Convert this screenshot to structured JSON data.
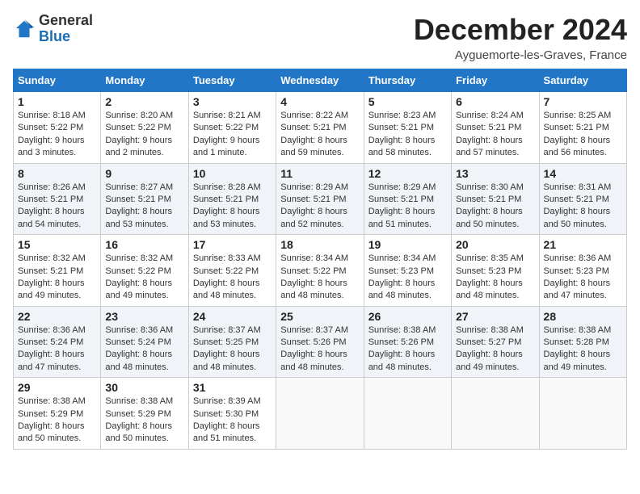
{
  "header": {
    "logo": {
      "general": "General",
      "blue": "Blue"
    },
    "title": "December 2024",
    "location": "Ayguemorte-les-Graves, France"
  },
  "weekdays": [
    "Sunday",
    "Monday",
    "Tuesday",
    "Wednesday",
    "Thursday",
    "Friday",
    "Saturday"
  ],
  "weeks": [
    [
      {
        "day": "1",
        "sunrise": "8:18 AM",
        "sunset": "5:22 PM",
        "daylight": "9 hours and 3 minutes."
      },
      {
        "day": "2",
        "sunrise": "8:20 AM",
        "sunset": "5:22 PM",
        "daylight": "9 hours and 2 minutes."
      },
      {
        "day": "3",
        "sunrise": "8:21 AM",
        "sunset": "5:22 PM",
        "daylight": "9 hours and 1 minute."
      },
      {
        "day": "4",
        "sunrise": "8:22 AM",
        "sunset": "5:21 PM",
        "daylight": "8 hours and 59 minutes."
      },
      {
        "day": "5",
        "sunrise": "8:23 AM",
        "sunset": "5:21 PM",
        "daylight": "8 hours and 58 minutes."
      },
      {
        "day": "6",
        "sunrise": "8:24 AM",
        "sunset": "5:21 PM",
        "daylight": "8 hours and 57 minutes."
      },
      {
        "day": "7",
        "sunrise": "8:25 AM",
        "sunset": "5:21 PM",
        "daylight": "8 hours and 56 minutes."
      }
    ],
    [
      {
        "day": "8",
        "sunrise": "8:26 AM",
        "sunset": "5:21 PM",
        "daylight": "8 hours and 54 minutes."
      },
      {
        "day": "9",
        "sunrise": "8:27 AM",
        "sunset": "5:21 PM",
        "daylight": "8 hours and 53 minutes."
      },
      {
        "day": "10",
        "sunrise": "8:28 AM",
        "sunset": "5:21 PM",
        "daylight": "8 hours and 53 minutes."
      },
      {
        "day": "11",
        "sunrise": "8:29 AM",
        "sunset": "5:21 PM",
        "daylight": "8 hours and 52 minutes."
      },
      {
        "day": "12",
        "sunrise": "8:29 AM",
        "sunset": "5:21 PM",
        "daylight": "8 hours and 51 minutes."
      },
      {
        "day": "13",
        "sunrise": "8:30 AM",
        "sunset": "5:21 PM",
        "daylight": "8 hours and 50 minutes."
      },
      {
        "day": "14",
        "sunrise": "8:31 AM",
        "sunset": "5:21 PM",
        "daylight": "8 hours and 50 minutes."
      }
    ],
    [
      {
        "day": "15",
        "sunrise": "8:32 AM",
        "sunset": "5:21 PM",
        "daylight": "8 hours and 49 minutes."
      },
      {
        "day": "16",
        "sunrise": "8:32 AM",
        "sunset": "5:22 PM",
        "daylight": "8 hours and 49 minutes."
      },
      {
        "day": "17",
        "sunrise": "8:33 AM",
        "sunset": "5:22 PM",
        "daylight": "8 hours and 48 minutes."
      },
      {
        "day": "18",
        "sunrise": "8:34 AM",
        "sunset": "5:22 PM",
        "daylight": "8 hours and 48 minutes."
      },
      {
        "day": "19",
        "sunrise": "8:34 AM",
        "sunset": "5:23 PM",
        "daylight": "8 hours and 48 minutes."
      },
      {
        "day": "20",
        "sunrise": "8:35 AM",
        "sunset": "5:23 PM",
        "daylight": "8 hours and 48 minutes."
      },
      {
        "day": "21",
        "sunrise": "8:36 AM",
        "sunset": "5:23 PM",
        "daylight": "8 hours and 47 minutes."
      }
    ],
    [
      {
        "day": "22",
        "sunrise": "8:36 AM",
        "sunset": "5:24 PM",
        "daylight": "8 hours and 47 minutes."
      },
      {
        "day": "23",
        "sunrise": "8:36 AM",
        "sunset": "5:24 PM",
        "daylight": "8 hours and 48 minutes."
      },
      {
        "day": "24",
        "sunrise": "8:37 AM",
        "sunset": "5:25 PM",
        "daylight": "8 hours and 48 minutes."
      },
      {
        "day": "25",
        "sunrise": "8:37 AM",
        "sunset": "5:26 PM",
        "daylight": "8 hours and 48 minutes."
      },
      {
        "day": "26",
        "sunrise": "8:38 AM",
        "sunset": "5:26 PM",
        "daylight": "8 hours and 48 minutes."
      },
      {
        "day": "27",
        "sunrise": "8:38 AM",
        "sunset": "5:27 PM",
        "daylight": "8 hours and 49 minutes."
      },
      {
        "day": "28",
        "sunrise": "8:38 AM",
        "sunset": "5:28 PM",
        "daylight": "8 hours and 49 minutes."
      }
    ],
    [
      {
        "day": "29",
        "sunrise": "8:38 AM",
        "sunset": "5:29 PM",
        "daylight": "8 hours and 50 minutes."
      },
      {
        "day": "30",
        "sunrise": "8:38 AM",
        "sunset": "5:29 PM",
        "daylight": "8 hours and 50 minutes."
      },
      {
        "day": "31",
        "sunrise": "8:39 AM",
        "sunset": "5:30 PM",
        "daylight": "8 hours and 51 minutes."
      },
      null,
      null,
      null,
      null
    ]
  ]
}
